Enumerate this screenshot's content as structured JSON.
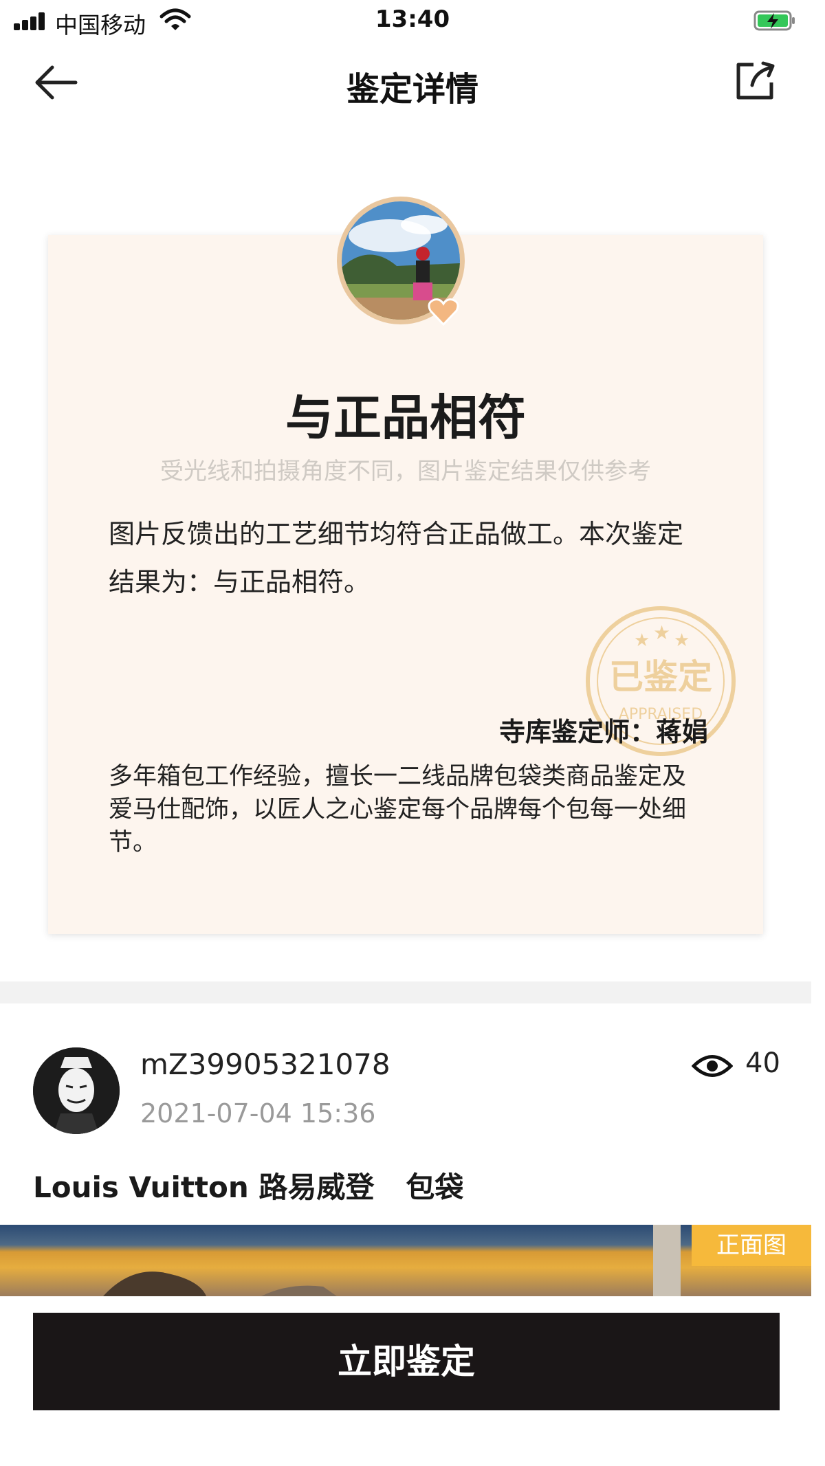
{
  "status_bar": {
    "carrier": "中国移动",
    "time": "13:40"
  },
  "nav": {
    "title": "鉴定详情",
    "back_icon": "arrow-left-icon",
    "share_icon": "share-icon"
  },
  "result": {
    "title": "与正品相符",
    "disclaimer": "受光线和拍摄角度不同，图片鉴定结果仅供参考",
    "description": "图片反馈出的工艺细节均符合正品做工。本次鉴定结果为：与正品相符。",
    "stamp": {
      "text": "已鉴定",
      "sub_text": "APPRAISED"
    },
    "appraiser_label": "寺库鉴定师：蒋娟",
    "appraiser_bio": "多年箱包工作经验，擅长一二线品牌包袋类商品鉴定及爱马仕配饰，以匠人之心鉴定每个品牌每个包每一处细节。"
  },
  "post": {
    "username": "mZ39905321078",
    "time": "2021-07-04 15:36",
    "views": "40",
    "brand": "Louis Vuitton 路易威登",
    "category": "包袋",
    "photo_tag": "正面图"
  },
  "cta": {
    "label": "立即鉴定"
  },
  "colors": {
    "card_bg": "#fdf5ee",
    "gold": "#e9c79f",
    "tag": "#f6b93b",
    "cta_bg": "#1a1617"
  }
}
